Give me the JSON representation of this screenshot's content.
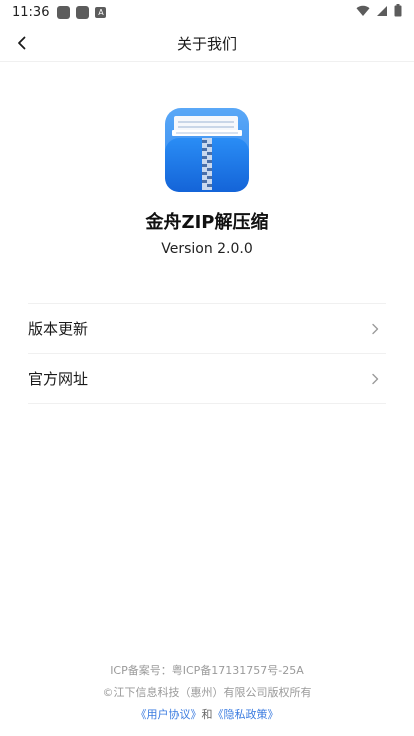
{
  "status_bar": {
    "time": "11:36",
    "notification_badge": "A",
    "icons": [
      "notification-icon",
      "notification-icon",
      "app-store-icon",
      "wifi-icon",
      "signal-icon",
      "battery-icon"
    ]
  },
  "header": {
    "title": "关于我们",
    "back_icon": "chevron-left-icon"
  },
  "app": {
    "name": "金舟ZIP解压缩",
    "version": "Version 2.0.0",
    "logo_icon": "zip-folder-icon"
  },
  "menu": {
    "items": [
      {
        "label": "版本更新",
        "icon": "chevron-right-icon"
      },
      {
        "label": "官方网址",
        "icon": "chevron-right-icon"
      }
    ]
  },
  "footer": {
    "icp": "ICP备案号：粤ICP备17131757号-25A",
    "copyright": "©江下信息科技（惠州）有限公司版权所有",
    "user_agreement": "《用户协议》",
    "and": "和",
    "privacy_policy": "《隐私政策》"
  },
  "colors": {
    "link": "#3a7be0",
    "logo_blue": "#1f7ff0",
    "footer_text": "#9a9a9a"
  }
}
